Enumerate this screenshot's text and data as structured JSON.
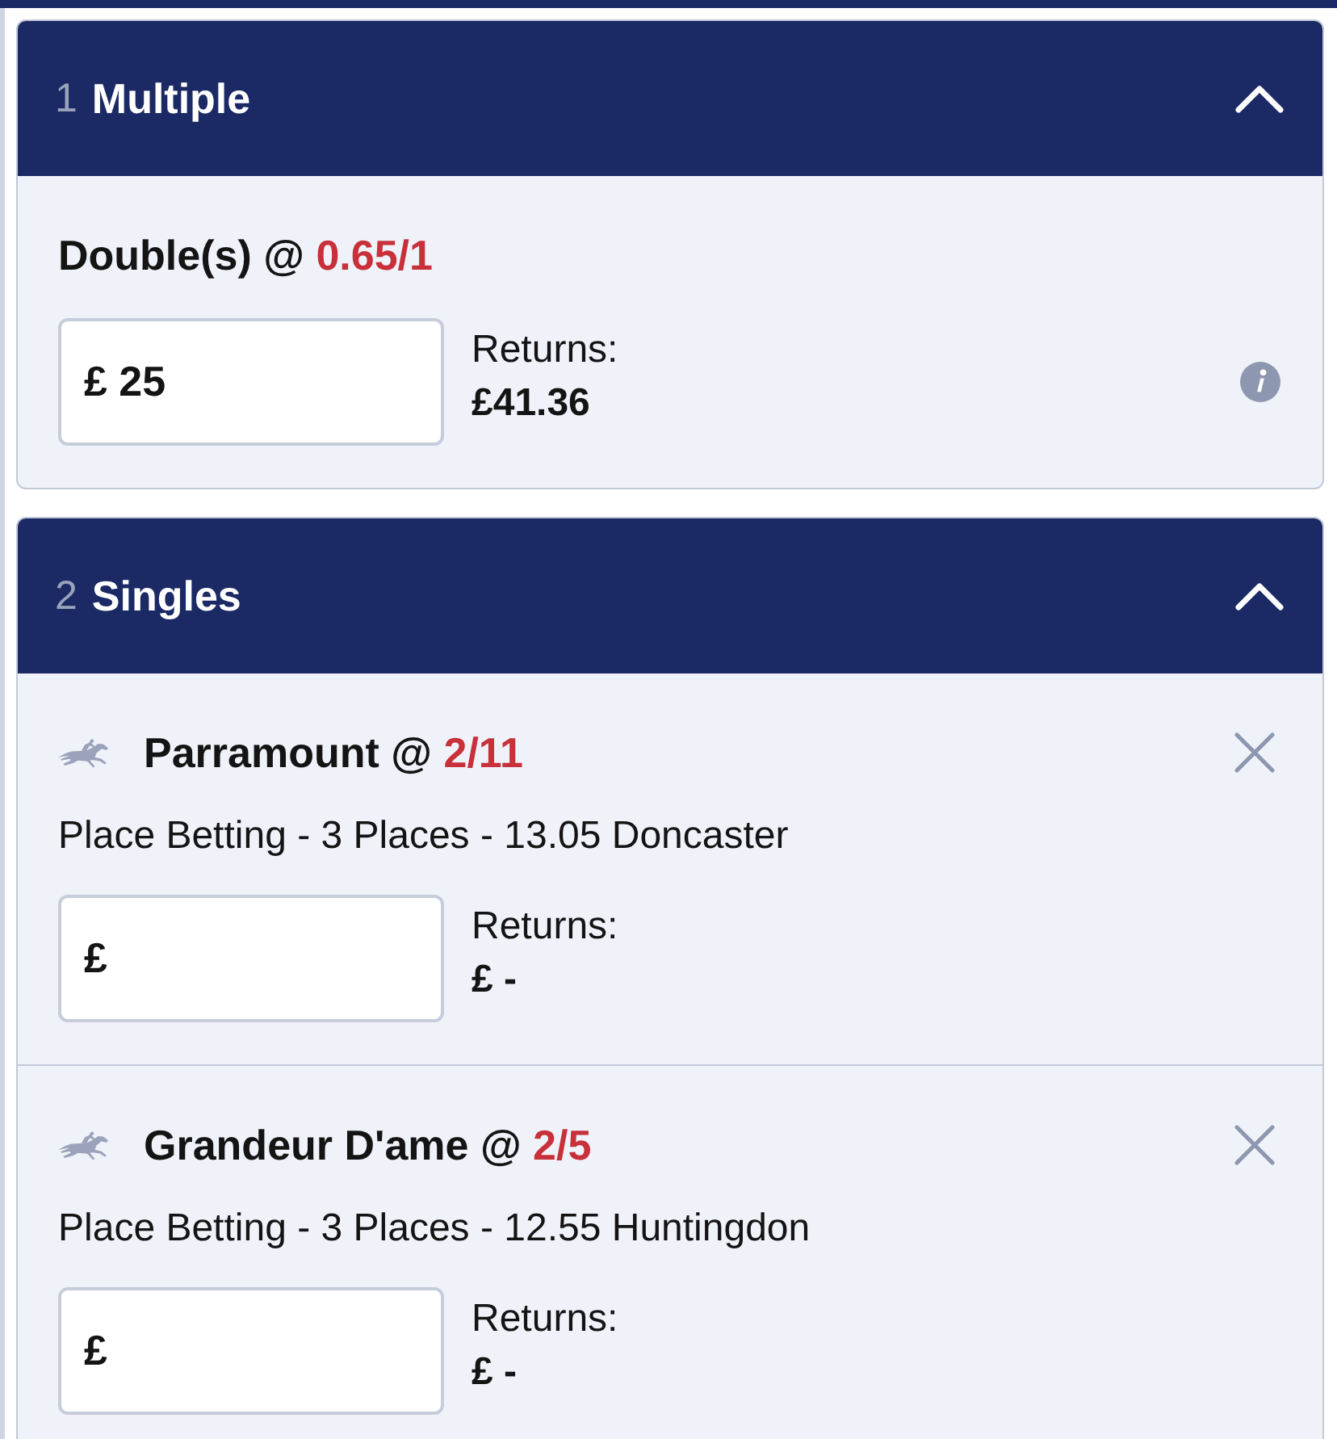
{
  "sections": [
    {
      "count": "1",
      "title": "Multiple",
      "expanded": true,
      "bets": [
        {
          "kind": "multiple",
          "selection": "Double(s) @",
          "odds": "0.65/1",
          "stake": {
            "currency": "£",
            "value": "25"
          },
          "returns_label": "Returns:",
          "returns": "£41.36"
        }
      ]
    },
    {
      "count": "2",
      "title": "Singles",
      "expanded": true,
      "bets": [
        {
          "kind": "single",
          "selection": "Parramount @",
          "odds": "2/11",
          "market": "Place Betting - 3 Places - 13.05 Doncaster",
          "stake": {
            "currency": "£"
          },
          "returns_label": "Returns:",
          "returns": "£ -"
        },
        {
          "kind": "single",
          "selection": "Grandeur D'ame @",
          "odds": "2/5",
          "market": "Place Betting - 3 Places - 12.55 Huntingdon",
          "stake": {
            "currency": "£"
          },
          "returns_label": "Returns:",
          "returns": "£ -"
        }
      ]
    }
  ]
}
